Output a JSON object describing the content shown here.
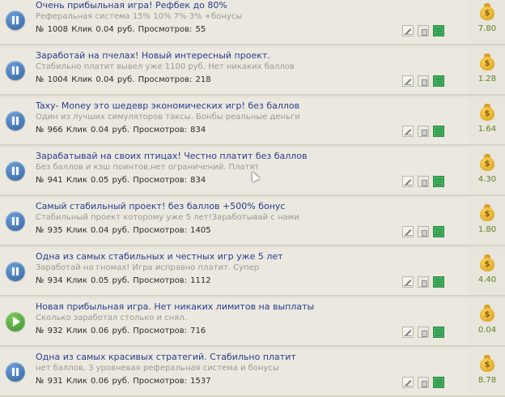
{
  "rows": [
    {
      "title": "Очень прибыльная игра! Рефбек до 80%",
      "desc": "Реферальная система 15% 10% 7% 3% +бонусы",
      "meta": "№ 1008  Клик 0.04 руб.  Просмотров: 55",
      "price": "7.80",
      "state": "pause"
    },
    {
      "title": "Заработай на пчелах! Новый интересный проект.",
      "desc": "Стабильно платит вывел уже 1100 руб. Нет никаких баллов",
      "meta": "№ 1004  Клик 0.04 руб.  Просмотров: 218",
      "price": "1.28",
      "state": "pause"
    },
    {
      "title": "Taxy- Money это шедевр экономических игр! без баллов",
      "desc": "Один из лучших симуляторов таксы. Бонбы реальные деньги",
      "meta": "№ 966  Клик 0.04 руб.  Просмотров: 834",
      "price": "1.64",
      "state": "pause"
    },
    {
      "title": "Зарабатывай на своих птицах! Честно платит без баллов",
      "desc": "Без баллов и кэш поинтов,нет ограничений. Платят",
      "meta": "№ 941  Клик 0.05 руб.  Просмотров: 834",
      "price": "4.30",
      "state": "pause"
    },
    {
      "title": "Самый стабильный проект! без баллов +500% бонус",
      "desc": "Стабильный проект которому уже 5 лет!Заработывай с нами",
      "meta": "№ 935  Клик 0.04 руб.  Просмотров: 1405",
      "price": "1.80",
      "state": "pause"
    },
    {
      "title": "Одна из самых стабильных и честных игр уже 5 лет",
      "desc": "Заработай на гномах! Игра исправно платит. Супер",
      "meta": "№ 934  Клик 0.05 руб.  Просмотров: 1112",
      "price": "4.40",
      "state": "pause"
    },
    {
      "title": "Новая прибыльная игра. Нет никаких лимитов на выплаты",
      "desc": "Сколько заработал столько и снял.",
      "meta": "№ 932  Клик 0.06 руб.  Просмотров: 716",
      "price": "0.04",
      "state": "play"
    },
    {
      "title": "Одна из самых красивых стратегий. Стабильно платит",
      "desc": "нет баллов, 3 уровневая реферальная система и бонусы",
      "meta": "№ 931  Клик 0.06 руб.  Просмотров: 1537",
      "price": "8.78",
      "state": "pause"
    }
  ],
  "currency_symbol": "$",
  "colors": {
    "title": "#2b3b8f",
    "desc": "#9a9890",
    "price": "#5f7d25",
    "pause": "#2c5f9e",
    "play": "#3a8a2a"
  }
}
